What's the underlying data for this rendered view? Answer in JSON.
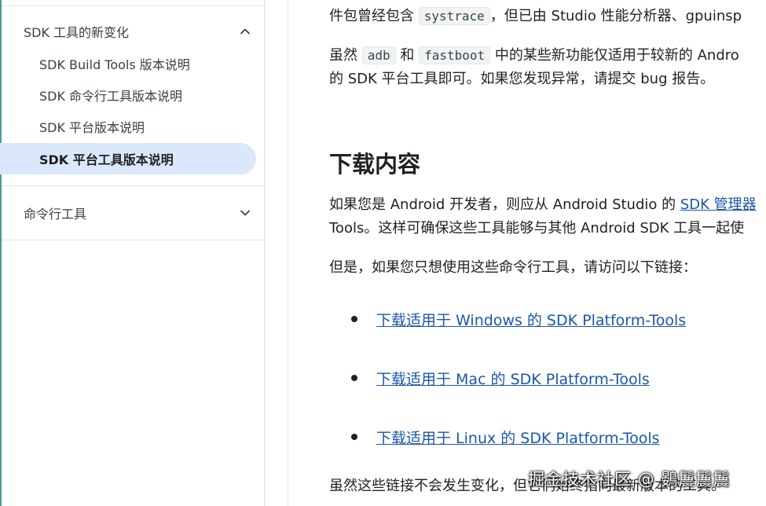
{
  "sidebar": {
    "section_sdk_tools": {
      "label": "SDK 工具的新变化",
      "state": "expanded"
    },
    "items": [
      {
        "label": "SDK Build Tools 版本说明",
        "active": false
      },
      {
        "label": "SDK 命令行工具版本说明",
        "active": false
      },
      {
        "label": "SDK 平台版本说明",
        "active": false
      },
      {
        "label": "SDK 平台工具版本说明",
        "active": true
      }
    ],
    "section_cmdline": {
      "label": "命令行工具",
      "state": "collapsed"
    }
  },
  "main": {
    "p1": {
      "before": "件包曾经包含 ",
      "code": "systrace",
      "after": "，但已由 Studio 性能分析器、gpuinsp"
    },
    "p2a": {
      "before": "虽然 ",
      "code1": "adb",
      "mid": " 和 ",
      "code2": "fastboot",
      "after": " 中的某些新功能仅适用于较新的 Andro"
    },
    "p2b": "的 SDK 平台工具即可。如果您发现异常，请提交 bug 报告。",
    "heading": "下载内容",
    "p3a": {
      "before": "如果您是 Android 开发者，则应从 Android Studio 的 ",
      "link": "SDK 管理器"
    },
    "p3b": "Tools。这样可确保这些工具能够与其他 Android SDK 工具一起使",
    "p4": "但是，如果您只想使用这些命令行工具，请访问以下链接：",
    "downloads": [
      "下载适用于 Windows 的 SDK Platform-Tools",
      "下载适用于 Mac 的 SDK Platform-Tools",
      "下载适用于 Linux 的 SDK Platform-Tools"
    ],
    "p5": "虽然这些链接不会发生变化，但它们始终指向最新版本的工具。"
  },
  "watermark": "掘金技术社区 @ 鷃鬞鬞鬞",
  "colors": {
    "link": "#1a57a9",
    "active_bg": "#dbe8fb",
    "sidebar_edge": "#4a9a9a"
  }
}
